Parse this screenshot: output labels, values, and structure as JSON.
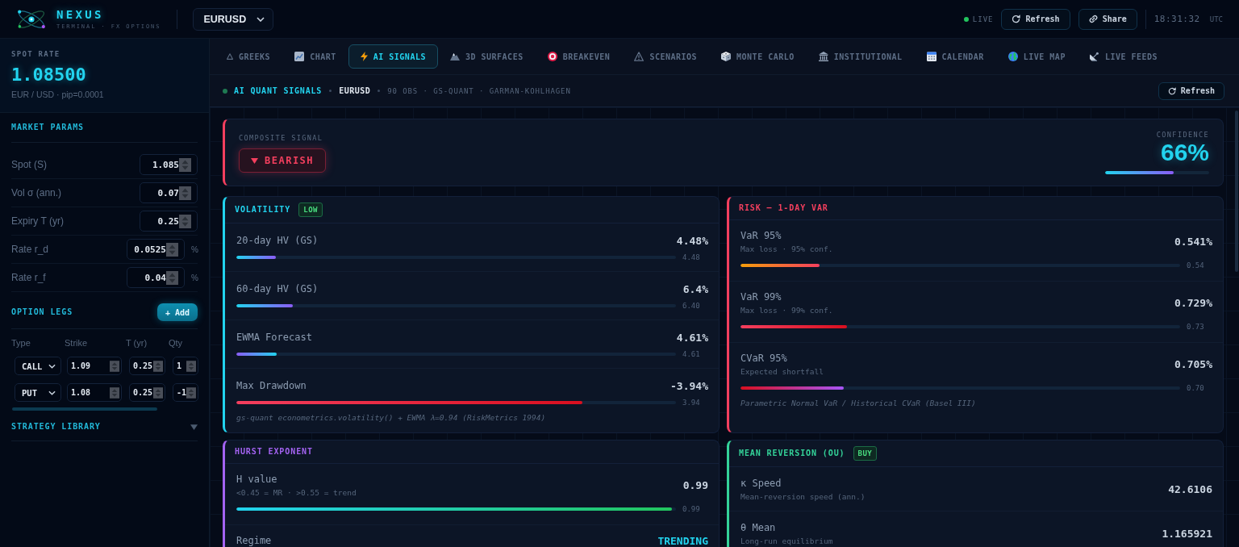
{
  "header": {
    "brand": "NEXUS",
    "tagline": "TERMINAL · FX OPTIONS",
    "pair": "EURUSD",
    "status": {
      "label": "LIVE",
      "live": true
    },
    "buttons": [
      {
        "label": "Refresh",
        "kind": "refresh"
      },
      {
        "label": "Share",
        "kind": "share"
      }
    ],
    "time": "18:31:32",
    "timezone": "UTC"
  },
  "sidebar": {
    "spot": {
      "label": "SPOT RATE",
      "value": "1.08500",
      "caption": "EUR / USD · pip=0.0001"
    },
    "market_params": {
      "title": "MARKET PARAMS",
      "fields": [
        {
          "label": "Spot (S)",
          "value": "1.085"
        },
        {
          "label": "Vol σ (ann.)",
          "value": "0.07"
        },
        {
          "label": "Expiry T (yr)",
          "value": "0.25"
        },
        {
          "label": "Rate r_d",
          "value": "0.0525",
          "unit": "%"
        },
        {
          "label": "Rate r_f",
          "value": "0.04",
          "unit": "%"
        }
      ]
    },
    "option_legs": {
      "title": "OPTION LEGS",
      "add_button": "+ Add",
      "columns": [
        "Type",
        "Strike",
        "T (yr)",
        "Qty"
      ],
      "legs": [
        {
          "type": "CALL",
          "strike": "1.09",
          "expiry": "0.25",
          "qty": "1"
        },
        {
          "type": "PUT",
          "strike": "1.08",
          "expiry": "0.25",
          "qty": "-1"
        }
      ]
    },
    "strategy_library": {
      "title": "STRATEGY LIBRARY",
      "expanded": false
    }
  },
  "tabs": [
    {
      "label": "GREEKS",
      "selected": false
    },
    {
      "label": "CHART",
      "selected": false
    },
    {
      "label": "AI SIGNALS",
      "selected": true
    },
    {
      "label": "3D SURFACES",
      "selected": false
    },
    {
      "label": "BREAKEVEN",
      "selected": false
    },
    {
      "label": "SCENARIOS",
      "selected": false
    },
    {
      "label": "MONTE CARLO",
      "selected": false
    },
    {
      "label": "INSTITUTIONAL",
      "selected": false
    },
    {
      "label": "CALENDAR",
      "selected": false
    },
    {
      "label": "LIVE MAP",
      "selected": false
    },
    {
      "label": "LIVE FEEDS",
      "selected": false
    }
  ],
  "signals_bar": {
    "title": "AI QUANT SIGNALS",
    "pair": "EURUSD",
    "meta": "90 OBS · GS-QUANT · GARMAN-KOHLHAGEN",
    "refresh_button": "Refresh"
  },
  "composite": {
    "label": "COMPOSITE SIGNAL",
    "signal": "BEARISH",
    "bearish": true,
    "confidence_label": "CONFIDENCE",
    "confidence": "66%",
    "level": 0.66
  },
  "cards": [
    {
      "title": "VOLATILITY",
      "color": "#22d3ee",
      "badge": "LOW",
      "rows": [
        {
          "kind": "meter",
          "label": "20-day HV (GS)",
          "value": "4.48%",
          "level": 0.09,
          "reading": "4.48"
        },
        {
          "kind": "meter",
          "label": "60-day HV (GS)",
          "value": "6.4%",
          "level": 0.128,
          "reading": "6.40"
        },
        {
          "kind": "meter",
          "label": "EWMA Forecast",
          "value": "4.61%",
          "level": 0.092,
          "reading": "4.61"
        },
        {
          "kind": "meter",
          "label": "Max Drawdown",
          "value": "-3.94%",
          "level": 0.788,
          "reading": "3.94"
        }
      ],
      "footnote": "gs-quant econometrics.volatility() + EWMA λ=0.94 (RiskMetrics 1994)"
    },
    {
      "title": "RISK — 1-DAY VAR",
      "color": "#f43f5e",
      "rows": [
        {
          "kind": "meter",
          "label": "VaR 95%",
          "note": "Max loss · 95% conf.",
          "value": "0.541%",
          "level": 0.18,
          "reading": "0.54"
        },
        {
          "kind": "meter",
          "label": "VaR 99%",
          "note": "Max loss · 99% conf.",
          "value": "0.729%",
          "level": 0.243,
          "reading": "0.73"
        },
        {
          "kind": "meter",
          "label": "CVaR 95%",
          "note": "Expected shortfall",
          "value": "0.705%",
          "level": 0.234,
          "reading": "0.70"
        }
      ],
      "footnote": "Parametric Normal VaR / Historical CVaR (Basel III)"
    },
    {
      "title": "HURST EXPONENT",
      "color": "#a463f2",
      "rows": [
        {
          "kind": "meter",
          "label": "H value",
          "note": "<0.45 = MR · >0.55 = trend",
          "value": "0.99",
          "level": 0.99,
          "reading": "0.99"
        },
        {
          "kind": "tag",
          "label": "Regime",
          "value": "TRENDING"
        }
      ]
    },
    {
      "title": "MEAN REVERSION (OU)",
      "color": "#34d399",
      "badge": "BUY",
      "rows": [
        {
          "kind": "stat",
          "label": "κ Speed",
          "note": "Mean-reversion speed (ann.)",
          "value": "42.6106"
        },
        {
          "kind": "stat",
          "label": "θ Mean",
          "note": "Long-run equilibrium",
          "value": "1.165921"
        }
      ]
    }
  ]
}
